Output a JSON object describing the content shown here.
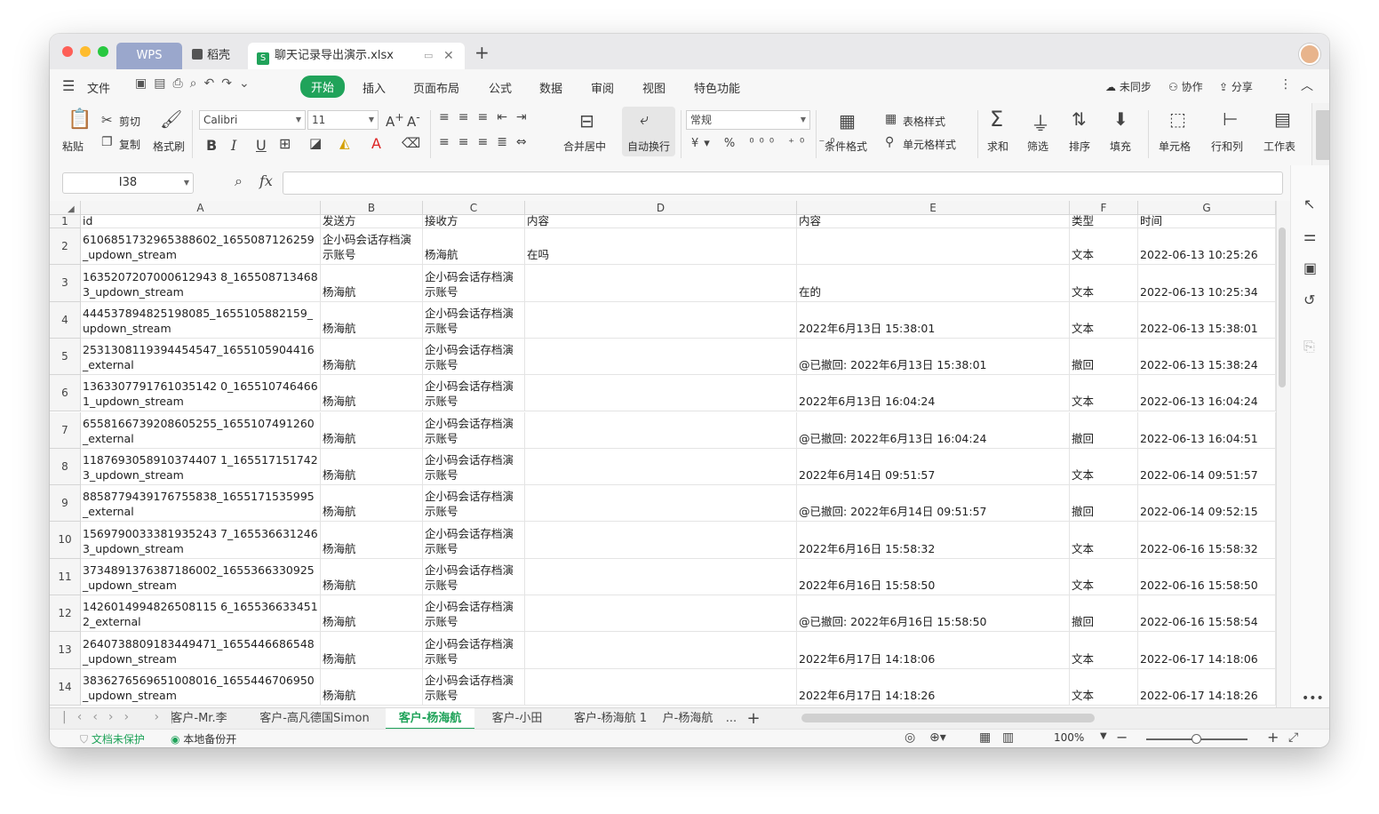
{
  "titlebar": {
    "tab_wps": "WPS",
    "tab_daoke": "稻壳",
    "tab_file": "聊天记录导出演示.xlsx",
    "new_tab": "+"
  },
  "menu": {
    "file": "文件",
    "tabs": [
      "开始",
      "插入",
      "页面布局",
      "公式",
      "数据",
      "审阅",
      "视图",
      "特色功能"
    ],
    "sync": "未同步",
    "collab": "协作",
    "share": "分享"
  },
  "toolbar": {
    "paste": "粘贴",
    "cut": "剪切",
    "copy": "复制",
    "format_painter": "格式刷",
    "font_name": "Calibri",
    "font_size": "11",
    "merge_center": "合并居中",
    "wrap_text": "自动换行",
    "number_format": "常规",
    "conditional_format": "条件格式",
    "table_style": "表格样式",
    "cell_style": "单元格样式",
    "sum": "求和",
    "filter": "筛选",
    "sort": "排序",
    "fill": "填充",
    "cell": "单元格",
    "row_col": "行和列",
    "worksheet": "工作表"
  },
  "formula_bar": {
    "name_box": "I38",
    "value": ""
  },
  "columns": [
    "A",
    "B",
    "C",
    "D",
    "E",
    "F",
    "G"
  ],
  "rows": [
    {
      "num": "1",
      "a": "id",
      "b": "发送方",
      "c": "接收方",
      "d": "内容",
      "e": "内容",
      "f": "类型",
      "g": "时间"
    },
    {
      "num": "2",
      "a": "6106851732965388602_1655087126259_updown_stream",
      "b": "企小码会话存档演示账号",
      "c": "杨海航",
      "d": "在吗",
      "e": "",
      "f": "文本",
      "g": "2022-06-13 10:25:26"
    },
    {
      "num": "3",
      "a": "1635207207000612943 8_1655087134683_updown_stream",
      "b": "杨海航",
      "c": "企小码会话存档演示账号",
      "d": "",
      "e": "在的",
      "f": "文本",
      "g": "2022-06-13 10:25:34"
    },
    {
      "num": "4",
      "a": "444537894825198085_1655105882159_updown_stream",
      "b": "杨海航",
      "c": "企小码会话存档演示账号",
      "d": "",
      "e": "2022年6月13日 15:38:01",
      "f": "文本",
      "g": "2022-06-13 15:38:01"
    },
    {
      "num": "5",
      "a": "2531308119394454547_1655105904416_external",
      "b": "杨海航",
      "c": "企小码会话存档演示账号",
      "d": "",
      "e": "@已撤回: 2022年6月13日 15:38:01",
      "f": "撤回",
      "g": "2022-06-13 15:38:24"
    },
    {
      "num": "6",
      "a": "1363307791761035142 0_1655107464661_updown_stream",
      "b": "杨海航",
      "c": "企小码会话存档演示账号",
      "d": "",
      "e": "2022年6月13日 16:04:24",
      "f": "文本",
      "g": "2022-06-13 16:04:24"
    },
    {
      "num": "7",
      "a": "6558166739208605255_1655107491260_external",
      "b": "杨海航",
      "c": "企小码会话存档演示账号",
      "d": "",
      "e": "@已撤回: 2022年6月13日 16:04:24",
      "f": "撤回",
      "g": "2022-06-13 16:04:51"
    },
    {
      "num": "8",
      "a": "1187693058910374407 1_1655171517423_updown_stream",
      "b": "杨海航",
      "c": "企小码会话存档演示账号",
      "d": "",
      "e": "2022年6月14日 09:51:57",
      "f": "文本",
      "g": "2022-06-14 09:51:57"
    },
    {
      "num": "9",
      "a": "8858779439176755838_1655171535995_external",
      "b": "杨海航",
      "c": "企小码会话存档演示账号",
      "d": "",
      "e": "@已撤回: 2022年6月14日 09:51:57",
      "f": "撤回",
      "g": "2022-06-14 09:52:15"
    },
    {
      "num": "10",
      "a": "1569790033381935243 7_1655366312463_updown_stream",
      "b": "杨海航",
      "c": "企小码会话存档演示账号",
      "d": "",
      "e": "2022年6月16日 15:58:32",
      "f": "文本",
      "g": "2022-06-16 15:58:32"
    },
    {
      "num": "11",
      "a": "3734891376387186002_1655366330925_updown_stream",
      "b": "杨海航",
      "c": "企小码会话存档演示账号",
      "d": "",
      "e": "2022年6月16日 15:58:50",
      "f": "文本",
      "g": "2022-06-16 15:58:50"
    },
    {
      "num": "12",
      "a": "1426014994826508115 6_1655366334512_external",
      "b": "杨海航",
      "c": "企小码会话存档演示账号",
      "d": "",
      "e": "@已撤回: 2022年6月16日 15:58:50",
      "f": "撤回",
      "g": "2022-06-16 15:58:54"
    },
    {
      "num": "13",
      "a": "2640738809183449471_1655446686548_updown_stream",
      "b": "杨海航",
      "c": "企小码会话存档演示账号",
      "d": "",
      "e": "2022年6月17日 14:18:06",
      "f": "文本",
      "g": "2022-06-17 14:18:06"
    },
    {
      "num": "14",
      "a": "3836276569651008016_1655446706950_updown_stream",
      "b": "杨海航",
      "c": "企小码会话存档演示账号",
      "d": "",
      "e": "2022年6月17日 14:18:26",
      "f": "文本",
      "g": "2022-06-17 14:18:26"
    }
  ],
  "sheets": [
    "客户-Mr.李",
    "客户-高凡德国Simon",
    "客户-杨海航",
    "客户-小田",
    "客户-杨海航 1",
    "户-杨海航",
    "..."
  ],
  "active_sheet": "客户-杨海航",
  "status": {
    "protect": "文档未保护",
    "backup": "本地备份开",
    "zoom": "100%"
  },
  "colors": {
    "accent": "#20a35a",
    "wps_tab": "#9aa7cc"
  }
}
